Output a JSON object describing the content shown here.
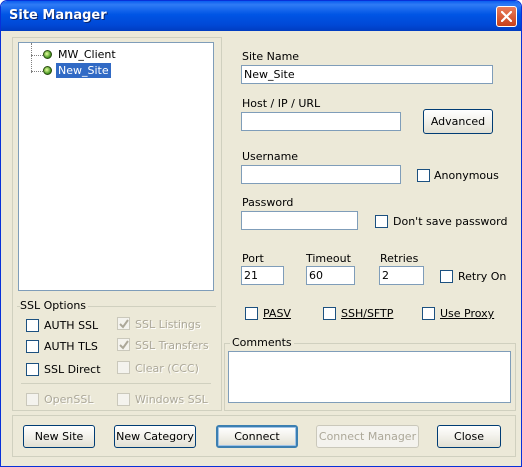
{
  "window": {
    "title": "Site Manager"
  },
  "tree": {
    "items": [
      {
        "label": "MW_Client",
        "selected": false
      },
      {
        "label": "New_Site",
        "selected": true
      }
    ]
  },
  "ssl_options": {
    "group_label": "SSL Options",
    "left": [
      {
        "label": "AUTH SSL",
        "checked": false,
        "enabled": true
      },
      {
        "label": "AUTH TLS",
        "checked": false,
        "enabled": true
      },
      {
        "label": "SSL Direct",
        "checked": false,
        "enabled": true
      }
    ],
    "right": [
      {
        "label": "SSL Listings",
        "checked": true,
        "enabled": false
      },
      {
        "label": "SSL Transfers",
        "checked": true,
        "enabled": false
      },
      {
        "label": "Clear (CCC)",
        "checked": false,
        "enabled": false
      }
    ],
    "bottom": [
      {
        "label": "OpenSSL",
        "checked": false,
        "enabled": false
      },
      {
        "label": "Windows SSL",
        "checked": false,
        "enabled": false
      }
    ]
  },
  "site": {
    "name_label": "Site Name",
    "name_value": "New_Site",
    "host_label": "Host / IP / URL",
    "host_value": "",
    "advanced_label": "Advanced",
    "username_label": "Username",
    "username_value": "",
    "anonymous_label": "Anonymous",
    "password_label": "Password",
    "password_value": "",
    "dont_save_label": "Don't save password",
    "port_label": "Port",
    "port_value": "21",
    "timeout_label": "Timeout",
    "timeout_value": "60",
    "retries_label": "Retries",
    "retries_value": "2",
    "retry_on_label": "Retry On",
    "pasv_label": "PASV",
    "ssh_label": "SSH/SFTP",
    "proxy_label": "Use Proxy",
    "comments_label": "Comments",
    "comments_value": ""
  },
  "buttons": {
    "new_site": "New Site",
    "new_category": "New Category",
    "connect": "Connect",
    "connect_manager": "Connect Manager",
    "close": "Close"
  },
  "colors": {
    "titlebar": "#0055e5",
    "dialog_bg": "#ece9d8",
    "selection": "#316ac5",
    "close_button": "#d84b22"
  }
}
